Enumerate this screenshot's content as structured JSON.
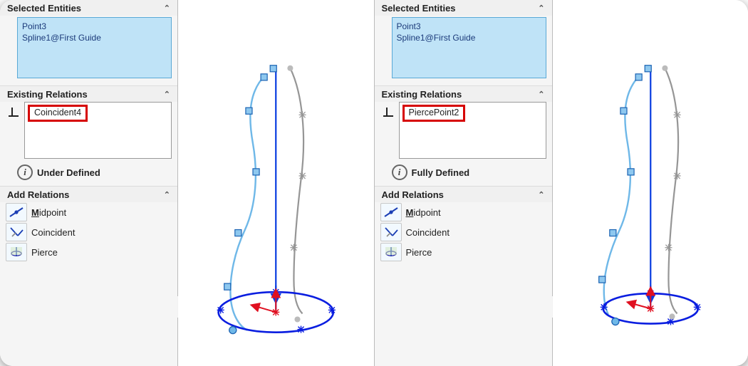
{
  "left": {
    "selected_entities": {
      "title": "Selected Entities",
      "items": [
        "Point3",
        "Spline1@First Guide"
      ]
    },
    "existing_relations": {
      "title": "Existing Relations",
      "items": [
        "Coincident4"
      ]
    },
    "status": {
      "text": "Under Defined",
      "icon_name": "info-icon"
    },
    "add_relations": {
      "title": "Add Relations",
      "items": [
        {
          "label": "Midpoint",
          "key": "M"
        },
        {
          "label": "Coincident",
          "key": "C"
        },
        {
          "label": "Pierce",
          "key": "P"
        }
      ]
    }
  },
  "right": {
    "selected_entities": {
      "title": "Selected Entities",
      "items": [
        "Point3",
        "Spline1@First Guide"
      ]
    },
    "existing_relations": {
      "title": "Existing Relations",
      "items": [
        "PiercePoint2"
      ]
    },
    "status": {
      "text": "Fully Defined",
      "icon_name": "info-icon"
    },
    "add_relations": {
      "title": "Add Relations",
      "items": [
        {
          "label": "Midpoint",
          "key": "M"
        },
        {
          "label": "Coincident",
          "key": "C"
        },
        {
          "label": "Pierce",
          "key": "P"
        }
      ]
    }
  },
  "icons": {
    "collapse": "⌃",
    "perpendicular": "perpendicular-relation-icon",
    "midpoint": "midpoint-relation-icon",
    "coincident": "coincident-relation-icon",
    "pierce": "pierce-relation-icon"
  },
  "colors": {
    "accent_blue": "#0a3ee0",
    "spline_blue": "#6fb8e8",
    "gray": "#969696",
    "highlight": "#d60000"
  }
}
